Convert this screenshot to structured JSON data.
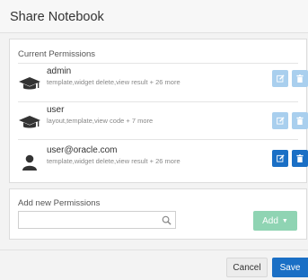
{
  "dialog": {
    "title": "Share Notebook"
  },
  "permissions": {
    "section_label": "Current Permissions",
    "rows": [
      {
        "icon": "graduation-cap-icon",
        "name": "admin",
        "detail": "template,widget delete,view result + 26 more",
        "buttons_style": "disabled"
      },
      {
        "icon": "graduation-cap-icon",
        "name": "user",
        "detail": "layout,template,view code + 7 more",
        "buttons_style": "disabled"
      },
      {
        "icon": "user-icon",
        "name": "user@oracle.com",
        "detail": "template,widget delete,view result + 26 more",
        "buttons_style": "active"
      }
    ]
  },
  "add_permissions": {
    "section_label": "Add new Permissions",
    "search_value": "",
    "add_label": "Add",
    "add_caret": "▼"
  },
  "footer": {
    "cancel_label": "Cancel",
    "save_label": "Save"
  },
  "colors": {
    "primary": "#1a6fc5",
    "primary_disabled": "#a9cfee",
    "add_button": "#8fd4b3"
  }
}
